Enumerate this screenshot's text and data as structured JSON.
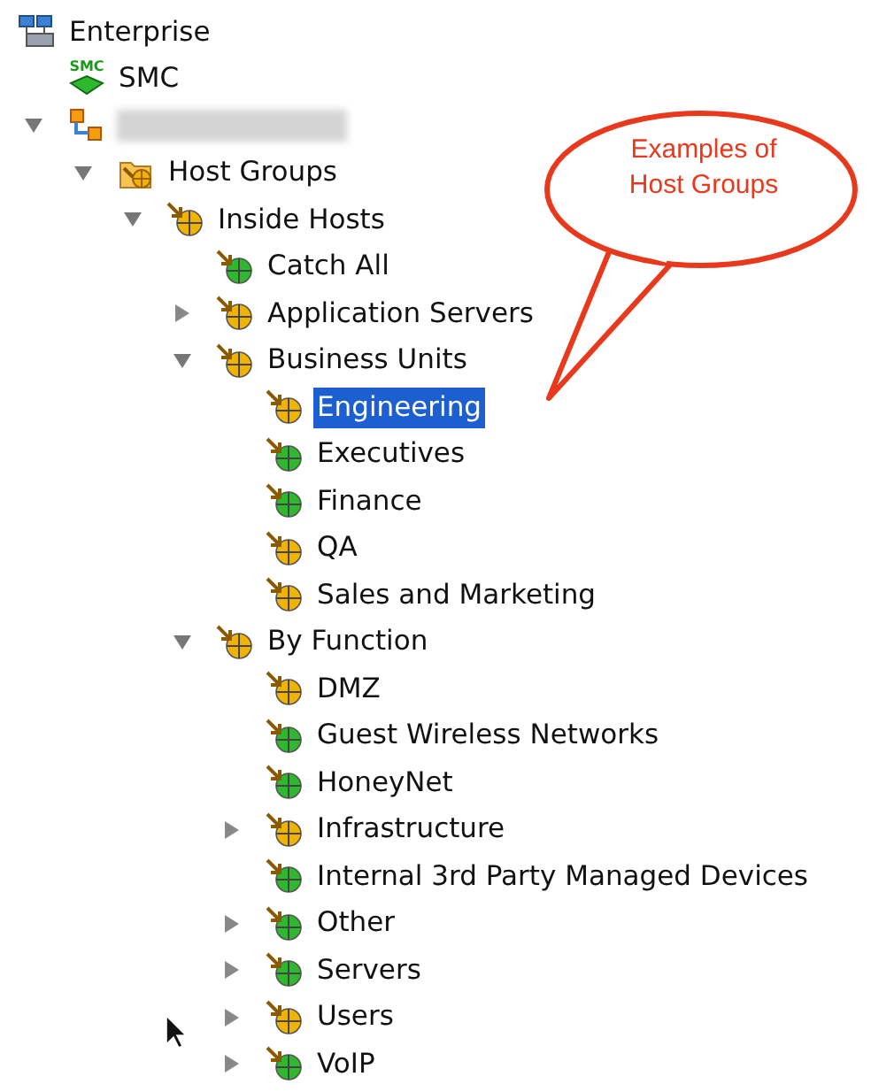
{
  "tree": [
    {
      "kind": "enterprise",
      "label": "Enterprise",
      "children": [
        {
          "kind": "smc",
          "label": "SMC",
          "icon_label": "SMC"
        },
        {
          "kind": "domain",
          "redacted": true,
          "expanded": true,
          "children": [
            {
              "kind": "hostgroups",
              "label": "Host Groups",
              "expanded": true,
              "children": [
                {
                  "kind": "group",
                  "label": "Inside Hosts",
                  "color": "#f0b400",
                  "expanded": true,
                  "selected": false,
                  "children": [
                    {
                      "kind": "group",
                      "label": "Catch All",
                      "color": "#2eb82e",
                      "selected": false
                    },
                    {
                      "kind": "group",
                      "label": "Application Servers",
                      "color": "#f0b400",
                      "expanded": false,
                      "selected": false
                    },
                    {
                      "kind": "group",
                      "label": "Business Units",
                      "color": "#f0b400",
                      "expanded": true,
                      "selected": false,
                      "children": [
                        {
                          "kind": "group",
                          "label": "Engineering",
                          "color": "#f0b400",
                          "selected": true
                        },
                        {
                          "kind": "group",
                          "label": "Executives",
                          "color": "#2eb82e",
                          "selected": false
                        },
                        {
                          "kind": "group",
                          "label": "Finance",
                          "color": "#2eb82e",
                          "selected": false
                        },
                        {
                          "kind": "group",
                          "label": "QA",
                          "color": "#f0b400",
                          "selected": false
                        },
                        {
                          "kind": "group",
                          "label": "Sales and Marketing",
                          "color": "#f0b400",
                          "selected": false
                        }
                      ]
                    },
                    {
                      "kind": "group",
                      "label": "By Function",
                      "color": "#f0b400",
                      "expanded": true,
                      "selected": false,
                      "children": [
                        {
                          "kind": "group",
                          "label": "DMZ",
                          "color": "#f0b400",
                          "selected": false
                        },
                        {
                          "kind": "group",
                          "label": "Guest Wireless Networks",
                          "color": "#2eb82e",
                          "selected": false
                        },
                        {
                          "kind": "group",
                          "label": "HoneyNet",
                          "color": "#2eb82e",
                          "selected": false
                        },
                        {
                          "kind": "group",
                          "label": "Infrastructure",
                          "color": "#f0b400",
                          "expanded": false,
                          "selected": false
                        },
                        {
                          "kind": "group",
                          "label": "Internal 3rd Party Managed Devices",
                          "color": "#2eb82e",
                          "selected": false
                        },
                        {
                          "kind": "group",
                          "label": "Other",
                          "color": "#2eb82e",
                          "expanded": false,
                          "selected": false
                        },
                        {
                          "kind": "group",
                          "label": "Servers",
                          "color": "#2eb82e",
                          "expanded": false,
                          "selected": false
                        },
                        {
                          "kind": "group",
                          "label": "Users",
                          "color": "#f0b400",
                          "expanded": false,
                          "selected": false
                        },
                        {
                          "kind": "group",
                          "label": "VoIP",
                          "color": "#2eb82e",
                          "expanded": false,
                          "selected": false
                        }
                      ]
                    }
                  ]
                }
              ]
            }
          ]
        }
      ]
    }
  ],
  "callout": {
    "text": "Examples of Host Groups"
  }
}
